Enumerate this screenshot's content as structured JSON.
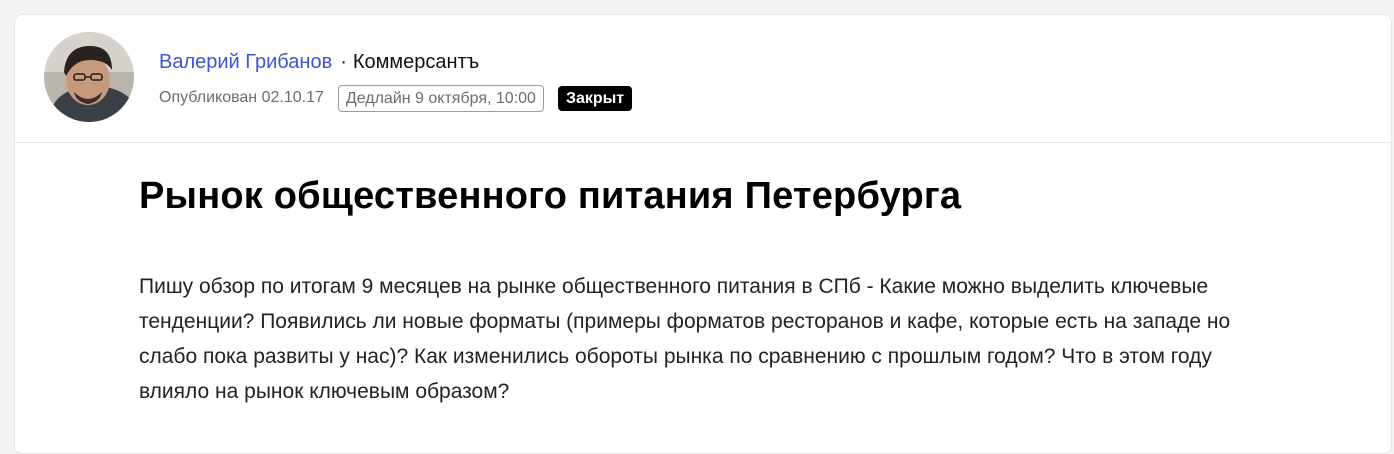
{
  "author": {
    "name": "Валерий Грибанов",
    "separator": "·",
    "outlet": "Коммерсантъ"
  },
  "meta": {
    "published": "Опубликован 02.10.17",
    "deadline": "Дедлайн 9 октября, 10:00",
    "status": "Закрыт"
  },
  "post": {
    "title": "Рынок общественного питания Петербурга",
    "body": "Пишу обзор по итогам 9 месяцев на рынке общественного питания в СПб - Какие можно выделить ключевые тенденции? Появились ли новые форматы (примеры форматов ресторанов и кафе, которые есть на западе но слабо пока развиты у нас)? Как изменились обороты рынка по сравнению с прошлым годом? Что в этом году влияло на рынок ключевым образом?"
  },
  "colors": {
    "author_link": "#3d54d6",
    "status_bg": "#000000",
    "card_bg": "#ffffff",
    "page_bg": "#f3f3f3"
  },
  "icons": {
    "avatar": "author-avatar-photo"
  }
}
